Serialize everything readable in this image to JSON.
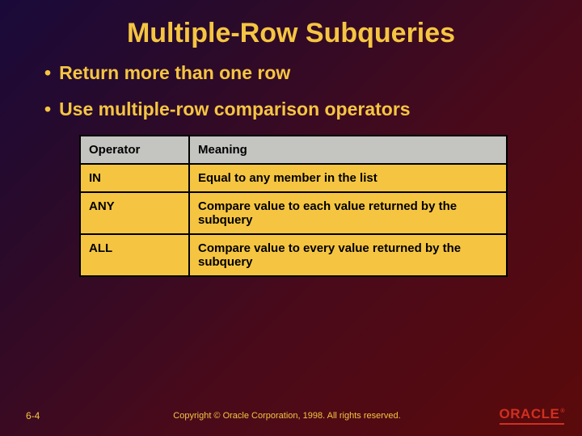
{
  "title": "Multiple-Row Subqueries",
  "bullets": [
    "Return more than one row",
    "Use multiple-row comparison operators"
  ],
  "table": {
    "headers": [
      "Operator",
      "Meaning"
    ],
    "rows": [
      {
        "op": "IN",
        "meaning": "Equal to any member in the list"
      },
      {
        "op": "ANY",
        "meaning": "Compare value to each value returned by the subquery"
      },
      {
        "op": "ALL",
        "meaning": "Compare value to every value returned by the subquery"
      }
    ]
  },
  "footer": {
    "slide_number": "6-4",
    "copyright": "Copyright © Oracle Corporation, 1998. All rights reserved.",
    "logo_text": "ORACLE",
    "logo_reg": "®"
  }
}
